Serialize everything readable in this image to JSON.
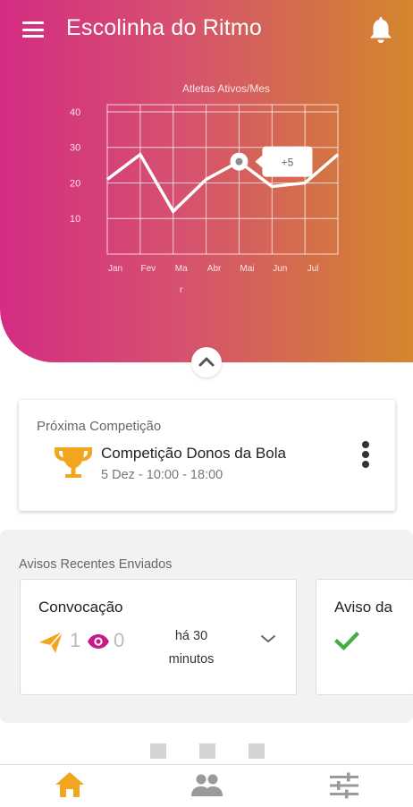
{
  "app": {
    "title": "Escolinha do Ritmo"
  },
  "icons": {
    "menu": "menu-icon",
    "notifications": "bell-icon",
    "collapse": "chevron-up-icon",
    "trophy": "trophy-icon",
    "more": "more-vertical-icon",
    "sent": "send-icon",
    "views": "eye-icon",
    "expand": "chevron-down-icon",
    "read": "check-icon",
    "nav_home": "home-icon",
    "nav_athletes": "people-icon",
    "nav_settings": "sliders-icon"
  },
  "colors": {
    "gradient_start": "#d42c83",
    "gradient_end": "#d3872c",
    "accent_orange": "#f2a51f",
    "accent_magenta": "#c8198a",
    "check_green": "#3fae49"
  },
  "chart_data": {
    "type": "line",
    "title": "Atletas Ativos/Mes",
    "categories": [
      "Jan",
      "Fev",
      "Mar",
      "Abr",
      "Mai",
      "Jun",
      "Jul",
      ""
    ],
    "category_labels": [
      "Jan",
      "Fev",
      "Ma\nr",
      "Abr",
      "Mai",
      "Jun",
      "Jul"
    ],
    "values": [
      21,
      28,
      12,
      21,
      26,
      19,
      20,
      28
    ],
    "y_ticks": [
      10,
      20,
      30,
      40
    ],
    "ylim": [
      0,
      42
    ],
    "grid": true,
    "highlight": {
      "index": 4,
      "label": "+5"
    }
  },
  "next_competition": {
    "label": "Próxima Competição",
    "name": "Competição Donos da Bola",
    "time": "5 Dez - 10:00 - 18:00"
  },
  "notices": {
    "title": "Avisos Recentes Enviados",
    "items": [
      {
        "title": "Convocação",
        "sent": "1",
        "views": "0",
        "time_line1": "há 30",
        "time_line2": "minutos"
      },
      {
        "title": "Aviso da"
      }
    ]
  },
  "pager": {
    "count": 3
  }
}
